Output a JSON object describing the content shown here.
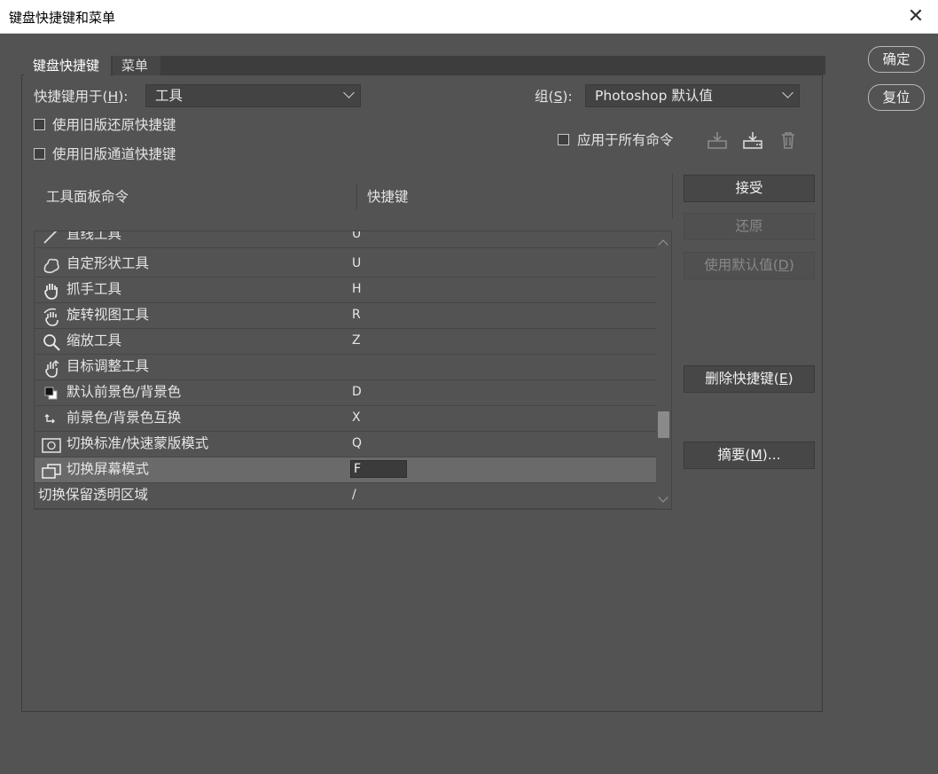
{
  "window": {
    "title": "键盘快捷键和菜单",
    "close_glyph": "✕"
  },
  "tabs": [
    {
      "label": "键盘快捷键"
    },
    {
      "label": "菜单"
    }
  ],
  "shortcuts_for": {
    "label_prefix": "快捷键用于(",
    "label_mnemonic": "H",
    "label_suffix": "):",
    "value": "工具"
  },
  "group": {
    "label_prefix": "组(",
    "label_mnemonic": "S",
    "label_suffix": "):",
    "value": "Photoshop 默认值"
  },
  "checkboxes": {
    "legacy_undo": "使用旧版还原快捷键",
    "legacy_channel": "使用旧版通道快捷键",
    "apply_all": "应用于所有命令"
  },
  "toolbar_icons": [
    "save-set-icon",
    "save-as-set-icon",
    "delete-set-icon"
  ],
  "buttons_right": {
    "ok": "确定",
    "reset": "复位"
  },
  "table": {
    "col_command": "工具面板命令",
    "col_shortcut": "快捷键",
    "rows": [
      {
        "name": "直线工具",
        "key": "U",
        "icon": "line-tool-icon"
      },
      {
        "name": "自定形状工具",
        "key": "U",
        "icon": "custom-shape-icon"
      },
      {
        "name": "抓手工具",
        "key": "H",
        "icon": "hand-tool-icon"
      },
      {
        "name": "旋转视图工具",
        "key": "R",
        "icon": "rotate-view-icon"
      },
      {
        "name": "缩放工具",
        "key": "Z",
        "icon": "zoom-tool-icon"
      },
      {
        "name": "目标调整工具",
        "key": "",
        "icon": "targeted-adjust-icon"
      },
      {
        "name": "默认前景色/背景色",
        "key": "D",
        "icon": "default-colors-icon"
      },
      {
        "name": "前景色/背景色互换",
        "key": "X",
        "icon": "swap-colors-icon"
      },
      {
        "name": "切换标准/快速蒙版模式",
        "key": "Q",
        "icon": "quick-mask-icon"
      },
      {
        "name": "切换屏幕模式",
        "key": "F",
        "icon": "screen-mode-icon",
        "selected": true
      },
      {
        "name": "切换保留透明区域",
        "key": "/",
        "icon": ""
      }
    ]
  },
  "side_buttons": {
    "accept": "接受",
    "undo": "还原",
    "use_default_prefix": "使用默认值(",
    "use_default_mnemonic": "D",
    "use_default_suffix": ")",
    "delete_prefix": "删除快捷键(",
    "delete_mnemonic": "E",
    "delete_suffix": ")",
    "summary_prefix": "摘要(",
    "summary_mnemonic": "M",
    "summary_suffix": ")..."
  }
}
